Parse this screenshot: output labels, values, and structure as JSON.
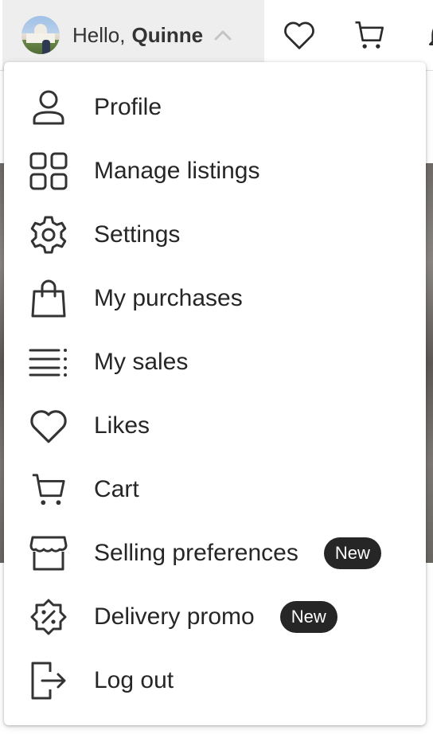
{
  "header": {
    "greeting_prefix": "Hello",
    "user_name": "Quinne",
    "icons": [
      "chevron-up-icon",
      "heart-icon",
      "cart-icon",
      "bell-icon"
    ]
  },
  "menu": {
    "items": [
      {
        "label": "Profile",
        "icon": "user-icon"
      },
      {
        "label": "Manage listings",
        "icon": "grid-icon"
      },
      {
        "label": "Settings",
        "icon": "gear-icon"
      },
      {
        "label": "My purchases",
        "icon": "shopping-bag-icon"
      },
      {
        "label": "My sales",
        "icon": "list-icon"
      },
      {
        "label": "Likes",
        "icon": "heart-icon"
      },
      {
        "label": "Cart",
        "icon": "cart-icon"
      },
      {
        "label": "Selling preferences",
        "icon": "storefront-icon",
        "badge": "New"
      },
      {
        "label": "Delivery promo",
        "icon": "discount-badge-icon",
        "badge": "New"
      },
      {
        "label": "Log out",
        "icon": "logout-icon"
      }
    ]
  },
  "colors": {
    "text": "#262626",
    "badge_bg": "#262626",
    "badge_text": "#ffffff",
    "trigger_bg": "#eeeeee"
  }
}
